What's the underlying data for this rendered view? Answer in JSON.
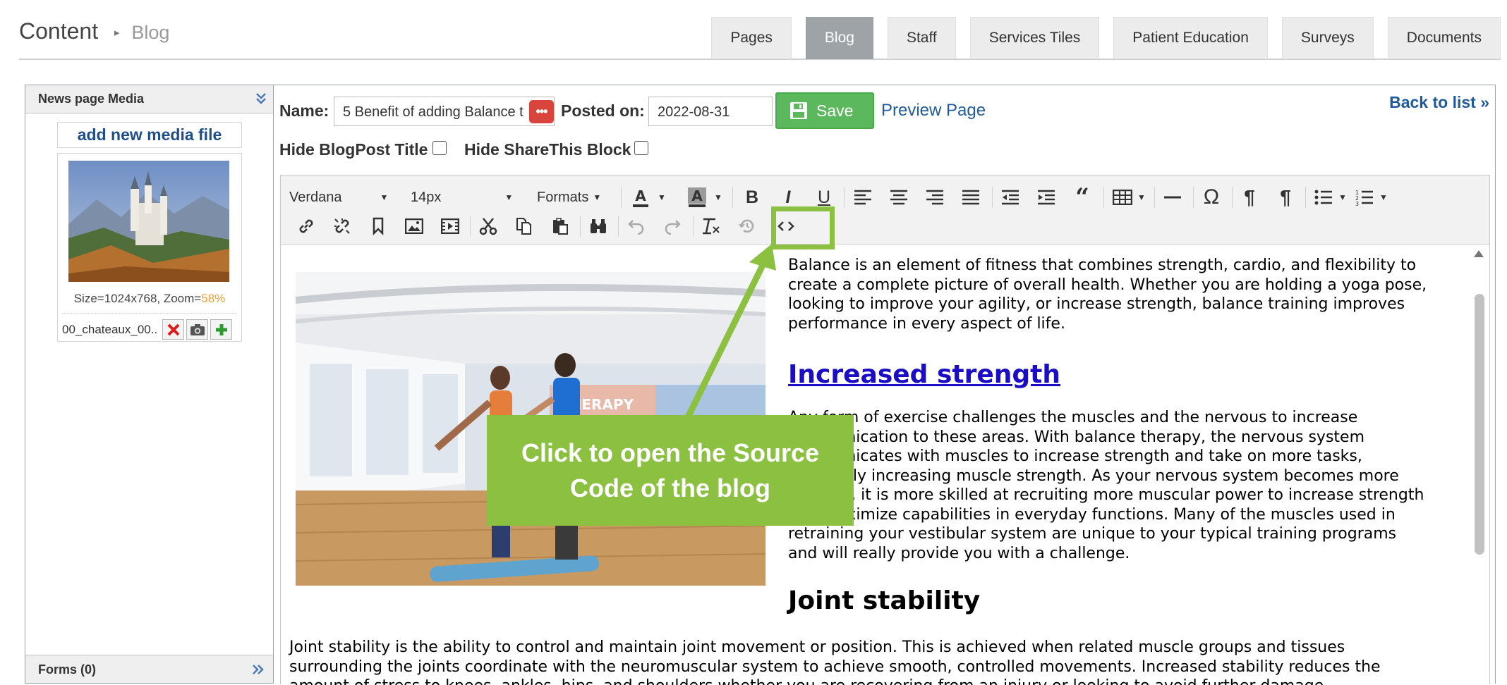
{
  "header": {
    "title": "Content",
    "crumb": "Blog",
    "tabs": [
      "Pages",
      "Blog",
      "Staff",
      "Services Tiles",
      "Patient Education",
      "Surveys",
      "Documents"
    ]
  },
  "sidebar": {
    "media_title": "News page Media",
    "add_media": "add new media file",
    "media_item": {
      "size_label": "Size=1024x768, Zoom=",
      "zoom": "58%",
      "file_name": "00_chateaux_00.."
    },
    "forms_title": "Forms (0)"
  },
  "form": {
    "name_label": "Name:",
    "name_value": "5 Benefit of adding Balance t",
    "name_badge": "•••",
    "posted_label": "Posted on:",
    "posted_value": "2022-08-31",
    "save_label": "Save",
    "preview_label": "Preview Page",
    "back_label": "Back to list »",
    "hide_title_label": "Hide BlogPost Title",
    "hide_share_label": "Hide ShareThis Block"
  },
  "toolbar": {
    "font_family": "Verdana",
    "font_size": "14px",
    "formats": "Formats"
  },
  "content": {
    "intro": [
      "Balance is an element of fitness that combines strength, cardio, and flexibility to",
      "create a complete picture of overall health. Whether you are holding a yoga pose,",
      "looking to improve your agility, or increase strength, balance training improves",
      "performance in every aspect of life."
    ],
    "heading1": "Increased strength ",
    "para2": [
      "Any form of exercise challenges the muscles and the nervous to increase",
      "communication to these areas. With balance therapy, the nervous system",
      "communicates with muscles to increase strength and take on more tasks,",
      "ultimately increasing muscle strength. As your nervous system becomes more",
      "efficient, it is more skilled at recruiting more muscular power to increase strength",
      "and maximize capabilities in everyday functions. Many of the muscles used in",
      "retraining your vestibular system are unique to your typical training programs",
      "and will really provide you with a challenge."
    ],
    "heading2": "Joint stability",
    "para3": [
      "Joint stability is the ability to control and maintain joint movement or position. This is achieved when related muscle groups and tissues",
      "surrounding the joints coordinate with the neuromuscular system to achieve smooth, controlled movements. Increased stability reduces the",
      "amount of stress to knees, ankles, hips, and shoulders whether you are recovering from an injury or looking to avoid further damage."
    ],
    "photo_sign": "THERAPY"
  },
  "callout": {
    "text": "Click to open the Source Code of the blog",
    "color": "#8bc040"
  }
}
